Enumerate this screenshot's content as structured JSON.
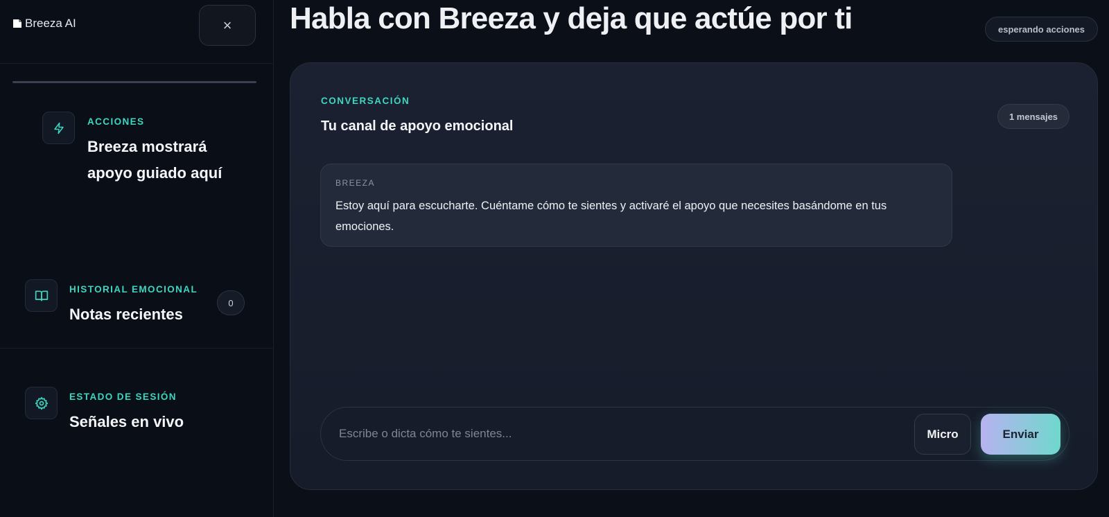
{
  "brand": {
    "name": "Breeza AI",
    "logo_icon": "broken-image-icon"
  },
  "sidebar": {
    "close_icon": "close-icon",
    "sections": [
      {
        "icon": "lightning-icon",
        "kicker": "ACCIONES",
        "title": "Breeza mostrará apoyo guiado aquí"
      },
      {
        "icon": "book-icon",
        "kicker": "HISTORIAL EMOCIONAL",
        "title": "Notas recientes",
        "count": "0"
      },
      {
        "icon": "gear-icon",
        "kicker": "ESTADO DE SESIÓN",
        "title": "Señales en vivo"
      }
    ]
  },
  "main": {
    "title": "Habla con Breeza y deja que actúe por ti",
    "status": "esperando acciones"
  },
  "chat": {
    "kicker": "CONVERSACIÓN",
    "heading": "Tu canal de apoyo emocional",
    "message_count": "1 mensajes",
    "messages": [
      {
        "author": "BREEZA",
        "text": "Estoy aquí para escucharte. Cuéntame cómo te sientes y activaré el apoyo que necesites basándome en tus emociones."
      }
    ],
    "input": {
      "placeholder": "Escribe o dicta cómo te sientes...",
      "value": ""
    },
    "micro_label": "Micro",
    "send_label": "Enviar"
  },
  "colors": {
    "accent": "#3dd6c0",
    "background": "#0b0f17",
    "card": "#1b2130"
  }
}
